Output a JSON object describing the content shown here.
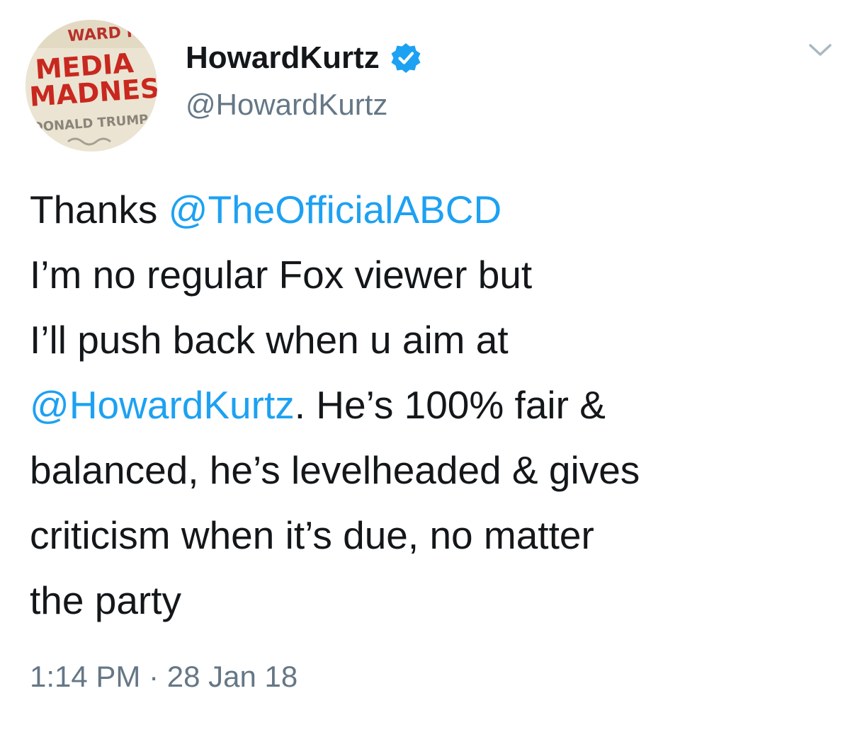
{
  "author": {
    "display_name": "HowardKurtz",
    "handle": "@HowardKurtz",
    "verified": true,
    "avatar": {
      "book_top_text": "WARD KUR",
      "book_title_line1": "MEDIA",
      "book_title_line2": "MADNESS",
      "book_subtitle": "DONALD TRUMP"
    }
  },
  "tweet": {
    "line1_text": "Thanks ",
    "line1_mention": "@TheOfficialABCD",
    "line2_text": "I’m no regular Fox viewer but",
    "line3_text": "I’ll push back when u aim at",
    "line4_mention": "@HowardKurtz",
    "line4_text": ". He’s 100% fair &",
    "line5_text": "balanced, he’s levelheaded & gives",
    "line6_text": "criticism when it’s due, no matter",
    "line7_text": "the party"
  },
  "meta": {
    "timestamp": "1:14 PM · 28 Jan 18"
  },
  "icons": {
    "verified": "verified-badge-icon",
    "menu": "chevron-down-icon"
  },
  "colors": {
    "link": "#1da1f2",
    "secondary_text": "#657786",
    "primary_text": "#14171a",
    "verified_badge": "#1da1f2",
    "avatar_red": "#c8281f"
  }
}
